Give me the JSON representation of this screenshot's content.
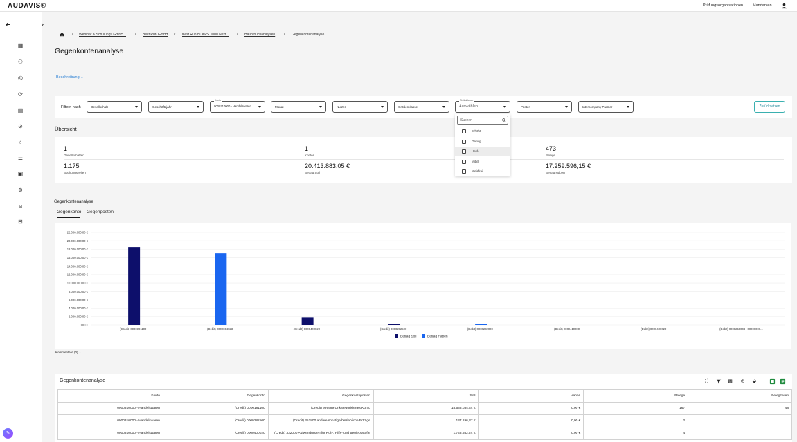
{
  "app": {
    "logo": "AUDAVIS®"
  },
  "topnav": {
    "items": [
      "Prüfungsorganisationen",
      "Mandanten"
    ]
  },
  "breadcrumb": [
    "Webinar & Schulungs GmbH...",
    "Best Run GmbH",
    "Best Run BUKRS 1000 Next...",
    "Hauptbuchanalysen",
    "Gegenkontenanalyse"
  ],
  "page": {
    "title": "Gegenkontenanalyse",
    "description_toggle": "Beschreibung"
  },
  "filters": {
    "label": "Filtern nach",
    "reset": "Zurücksetzen",
    "selects": [
      {
        "label": "",
        "value": "Gesellschaft"
      },
      {
        "label": "",
        "value": "Geschäftsjahr"
      },
      {
        "label": "Konto",
        "value": "0000310000 - Handelswaren"
      },
      {
        "label": "",
        "value": "Monat"
      },
      {
        "label": "",
        "value": "Nutzer"
      },
      {
        "label": "",
        "value": "Größenklasse"
      },
      {
        "label": "Risikoklasse",
        "value": "Auswählen"
      },
      {
        "label": "",
        "value": "Posten"
      },
      {
        "label": "",
        "value": "Intercompany Partner"
      }
    ]
  },
  "risk_dropdown": {
    "search_placeholder": "Suchen",
    "options": [
      "Erhöht",
      "Gering",
      "Hoch",
      "Mittel",
      "Weisfrei"
    ],
    "highlighted": "Hoch"
  },
  "overview": {
    "title": "Übersicht",
    "kpis": [
      {
        "value": "1",
        "label": "Gesellschaften"
      },
      {
        "value": "1",
        "label": "Konten"
      },
      {
        "value": "473",
        "label": "Belege"
      },
      {
        "value": "1.175",
        "label": "Buchungszeilen"
      },
      {
        "value": "20.413.883,05 €",
        "label": "Betrag Soll"
      },
      {
        "value": "17.259.596,15 €",
        "label": "Betrag Haben"
      }
    ]
  },
  "analysis": {
    "title": "Gegenkontenanalyse",
    "tabs": [
      "Gegenkonto",
      "Gegenposten"
    ],
    "active_tab": "Gegenkonto",
    "comments": "Kommentare (0)"
  },
  "chart_data": {
    "type": "bar",
    "categories": [
      "(Credit) 0000191100",
      "(Debit) 0000654023",
      "(Credit) 0000400020",
      "(Credit) 0000282500",
      "(Debit) 0000232000",
      "(Debit) 0000410000",
      "(Debit) 0000400020",
      "(Debit) 0000250004 | 00000000..."
    ],
    "series": [
      {
        "name": "Betrag Soll",
        "color": "#0d0f6b",
        "values": [
          18533034.44,
          0,
          1743652.24,
          137196.37,
          0,
          0,
          0,
          0
        ]
      },
      {
        "name": "Betrag Haben",
        "color": "#1a66f0",
        "values": [
          0,
          17050000,
          0,
          0,
          30000,
          0,
          0,
          0
        ]
      }
    ],
    "ylim": [
      0,
      22000000
    ],
    "yticks": [
      "0,00 €",
      "2.000.000,00 €",
      "4.000.000,00 €",
      "6.000.000,00 €",
      "8.000.000,00 €",
      "10.000.000,00 €",
      "12.000.000,00 €",
      "14.000.000,00 €",
      "16.000.000,00 €",
      "18.000.000,00 €",
      "20.000.000,00 €",
      "22.000.000,00 €"
    ],
    "legend": "bottom-center",
    "grid": true
  },
  "table": {
    "title": "Gegenkontenanalyse",
    "columns": [
      "Konto",
      "Gegenkonto",
      "Gegenkontoposten",
      "Soll",
      "Haben",
      "Belege",
      "Belegzeilen"
    ],
    "rows": [
      [
        "0000310000 - Handelswaren",
        "(Credit) 0000191100",
        "(Credit) 999999 Unkategorisiertes Konto",
        "18.533.034,44 €",
        "0,00 €",
        "167",
        "48"
      ],
      [
        "0000310000 - Handelswaren",
        "(Credit) 0000282500",
        "(Credit) 351800 andere sonstige betriebliche Erträge",
        "137.196,37 €",
        "0,00 €",
        "2",
        ""
      ],
      [
        "0000310000 - Handelswaren",
        "(Credit) 0000400020",
        "(Credit) 332000 Aufwendungen für Roh-, Hilfs- und Betriebsstoffe",
        "1.743.652,24 €",
        "0,00 €",
        "4",
        ""
      ]
    ]
  },
  "icons": [
    "back-arrow-icon",
    "forward-arrow-icon",
    "home-icon",
    "user-icon",
    "expand-icon",
    "filter-icon",
    "qr-icon",
    "clear-filter-icon",
    "paint-icon",
    "export-excel-icon",
    "export-pdf-icon"
  ]
}
